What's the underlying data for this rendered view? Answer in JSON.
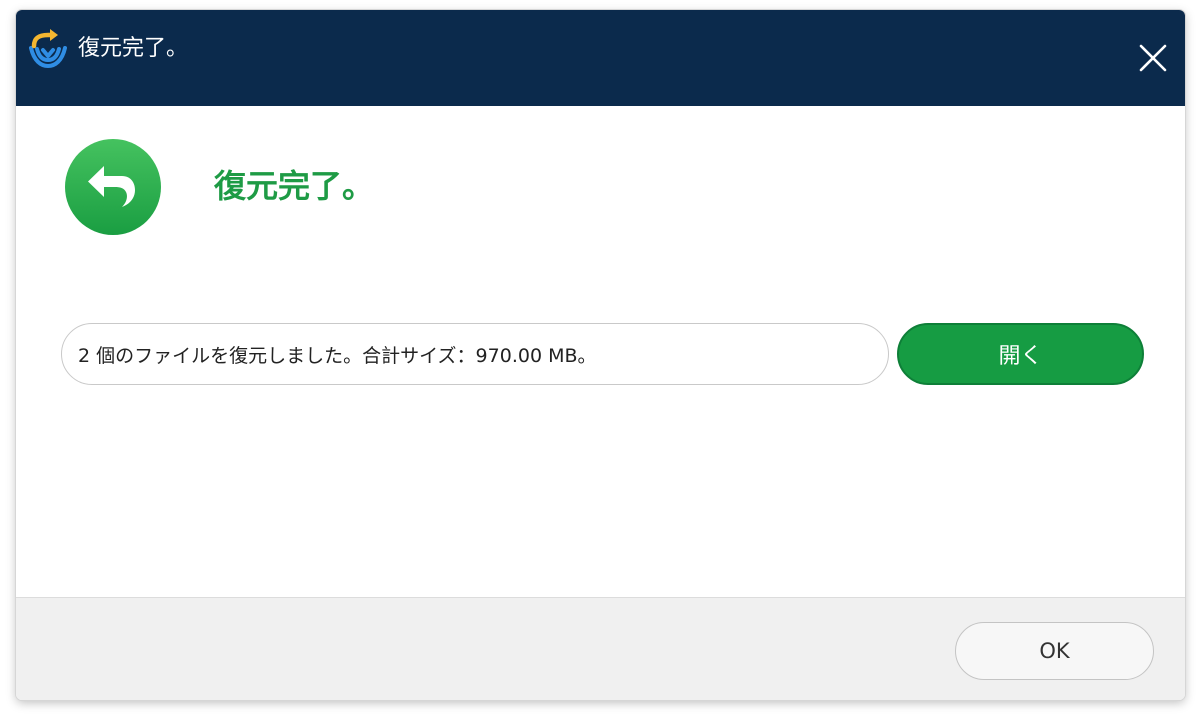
{
  "window": {
    "title": "復元完了。",
    "app_logo_icon": "recovery-logo-icon",
    "close_icon": "close-icon"
  },
  "main": {
    "heading": "復元完了。",
    "heading_icon": "undo-arrow-icon",
    "result_text": "2 個のファイルを復元しました。合計サイズ：970.00 MB。",
    "open_button_label": "開く"
  },
  "footer": {
    "ok_button_label": "OK"
  },
  "colors": {
    "titlebar": "#0b2a4c",
    "accent_green": "#169c43",
    "heading_green": "#1e9b45",
    "footer_bg": "#f0f0f0"
  }
}
